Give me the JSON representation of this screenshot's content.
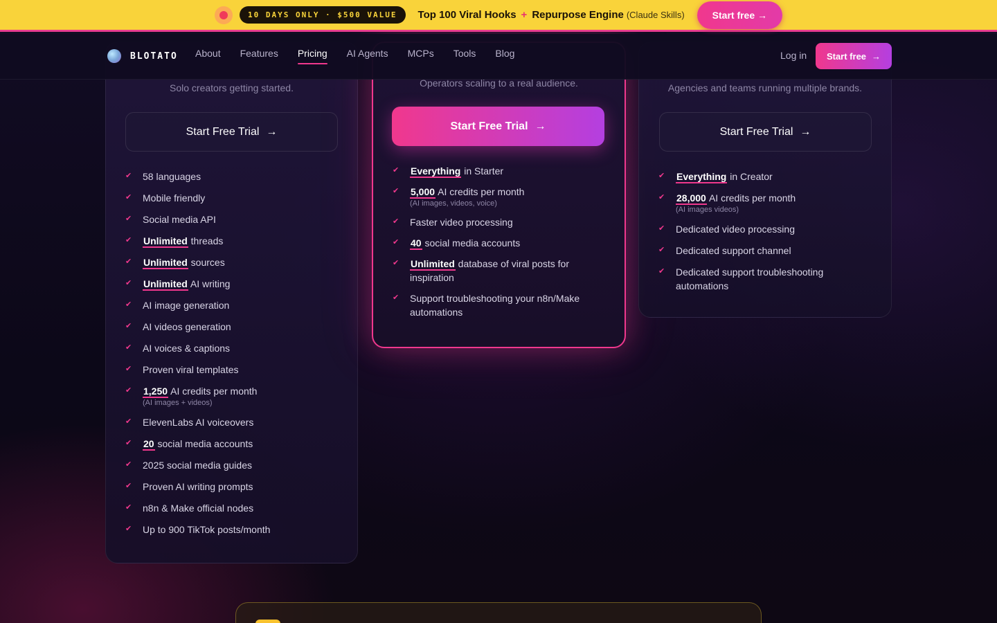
{
  "promo": {
    "badge": "10 DAYS ONLY · $500 VALUE",
    "headline": "Top 100 Viral Hooks",
    "plus": "+",
    "headline2": "Repurpose Engine",
    "sub": "(Claude Skills)",
    "cta": "Start free →",
    "colors": {
      "background": "#f9d33a",
      "accent": "#f0388d"
    }
  },
  "nav": {
    "brand": "BLOTATO",
    "links": [
      "About",
      "Features",
      "Pricing",
      "AI Agents",
      "MCPs",
      "Tools",
      "Blog"
    ],
    "active": "Pricing",
    "login": "Log in",
    "cta": "Start free",
    "cta_icon": "arrow-right-icon"
  },
  "plans": [
    {
      "tagline": "Solo creators getting started.",
      "cta": "Start Free Trial",
      "features": [
        {
          "text": "58 languages"
        },
        {
          "text": "Mobile friendly"
        },
        {
          "text": "Social media API"
        },
        {
          "hl": "Unlimited",
          "text": " threads"
        },
        {
          "hl": "Unlimited",
          "text": " sources"
        },
        {
          "hl": "Unlimited",
          "text": " AI writing"
        },
        {
          "text": "AI image generation"
        },
        {
          "text": "AI videos generation"
        },
        {
          "text": "AI voices & captions"
        },
        {
          "text": "Proven viral templates"
        },
        {
          "hl": "1,250",
          "text": " AI credits per month",
          "note": "(AI images + videos)"
        },
        {
          "text": "ElevenLabs AI voiceovers"
        },
        {
          "hl": "20",
          "text": " social media accounts"
        },
        {
          "text": "2025 social media guides"
        },
        {
          "text": "Proven AI writing prompts"
        },
        {
          "text": "n8n & Make official nodes"
        },
        {
          "text": "Up to 900 TikTok posts/month"
        }
      ]
    },
    {
      "tagline": "Operators scaling to a real audience.",
      "cta": "Start Free Trial",
      "features": [
        {
          "hl": "Everything",
          "text": " in Starter"
        },
        {
          "hl": "5,000",
          "text": " AI credits per month",
          "note": "(AI images, videos, voice)"
        },
        {
          "text": "Faster video processing"
        },
        {
          "hl": "40",
          "text": " social media accounts"
        },
        {
          "hl": "Unlimited",
          "text": " database of viral posts for inspiration"
        },
        {
          "text": "Support troubleshooting your n8n/Make automations"
        }
      ]
    },
    {
      "tagline": "Agencies and teams running multiple brands.",
      "cta": "Start Free Trial",
      "features": [
        {
          "hl": "Everything",
          "text": " in Creator"
        },
        {
          "hl": "28,000",
          "text": " AI credits per month",
          "note": "(AI images videos)"
        },
        {
          "text": "Dedicated video processing"
        },
        {
          "text": "Dedicated support channel"
        },
        {
          "text": "Dedicated support troubleshooting automations"
        }
      ]
    }
  ]
}
